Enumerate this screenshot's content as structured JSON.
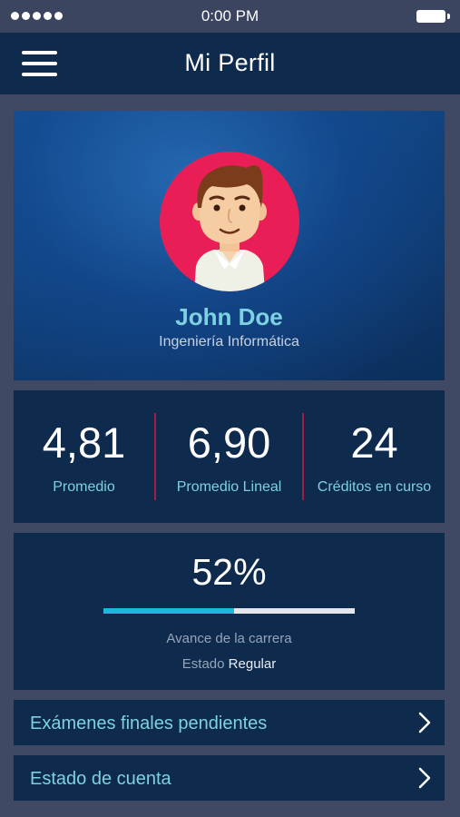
{
  "status_bar": {
    "time": "0:00 PM",
    "signal_icon": "signal-dots-icon",
    "battery_icon": "battery-icon"
  },
  "header": {
    "menu_icon": "hamburger-menu-icon",
    "title": "Mi Perfil"
  },
  "profile": {
    "avatar_icon": "user-avatar-icon",
    "name": "John Doe",
    "career": "Ingeniería Informática"
  },
  "stats": [
    {
      "value": "4,81",
      "label": "Promedio"
    },
    {
      "value": "6,90",
      "label": "Promedio Lineal"
    },
    {
      "value": "24",
      "label": "Créditos en curso"
    }
  ],
  "progress": {
    "percent_text": "52%",
    "percent_value": 52,
    "label": "Avance de la carrera",
    "state_label": "Estado",
    "state_value": "Regular"
  },
  "menu": [
    {
      "label": "Exámenes finales pendientes",
      "icon": "chevron-right-icon"
    },
    {
      "label": "Estado de cuenta",
      "icon": "chevron-right-icon"
    }
  ],
  "colors": {
    "background": "#3f4963",
    "card": "#0e2a4d",
    "accent": "#7ed1e2",
    "avatar_bg": "#ea1e56",
    "progress_fill": "#1eb6dd",
    "divider": "#a81d45"
  }
}
